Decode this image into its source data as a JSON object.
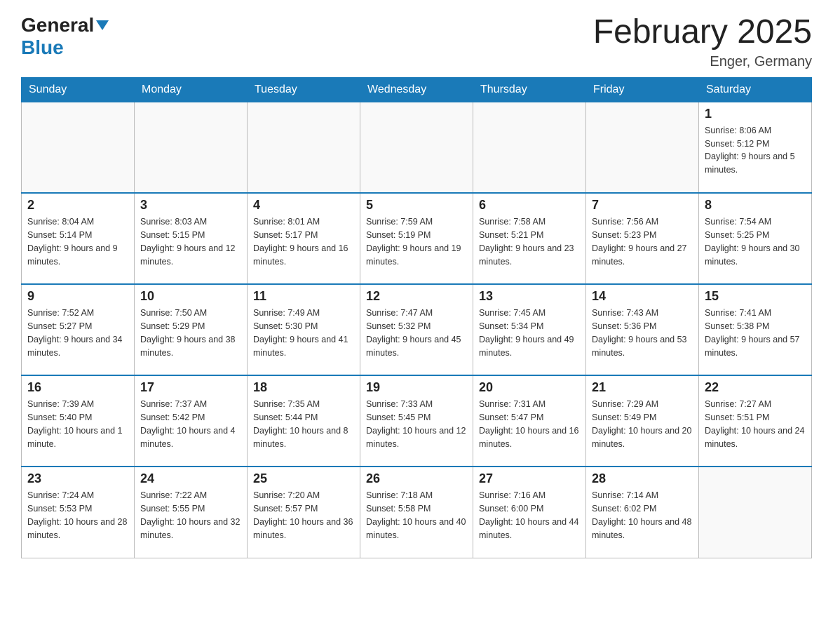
{
  "logo": {
    "general": "General",
    "blue": "Blue",
    "arrow": "▼"
  },
  "title": {
    "month_year": "February 2025",
    "location": "Enger, Germany"
  },
  "days_of_week": [
    "Sunday",
    "Monday",
    "Tuesday",
    "Wednesday",
    "Thursday",
    "Friday",
    "Saturday"
  ],
  "weeks": [
    {
      "days": [
        {
          "number": "",
          "info": ""
        },
        {
          "number": "",
          "info": ""
        },
        {
          "number": "",
          "info": ""
        },
        {
          "number": "",
          "info": ""
        },
        {
          "number": "",
          "info": ""
        },
        {
          "number": "",
          "info": ""
        },
        {
          "number": "1",
          "info": "Sunrise: 8:06 AM\nSunset: 5:12 PM\nDaylight: 9 hours and 5 minutes."
        }
      ]
    },
    {
      "days": [
        {
          "number": "2",
          "info": "Sunrise: 8:04 AM\nSunset: 5:14 PM\nDaylight: 9 hours and 9 minutes."
        },
        {
          "number": "3",
          "info": "Sunrise: 8:03 AM\nSunset: 5:15 PM\nDaylight: 9 hours and 12 minutes."
        },
        {
          "number": "4",
          "info": "Sunrise: 8:01 AM\nSunset: 5:17 PM\nDaylight: 9 hours and 16 minutes."
        },
        {
          "number": "5",
          "info": "Sunrise: 7:59 AM\nSunset: 5:19 PM\nDaylight: 9 hours and 19 minutes."
        },
        {
          "number": "6",
          "info": "Sunrise: 7:58 AM\nSunset: 5:21 PM\nDaylight: 9 hours and 23 minutes."
        },
        {
          "number": "7",
          "info": "Sunrise: 7:56 AM\nSunset: 5:23 PM\nDaylight: 9 hours and 27 minutes."
        },
        {
          "number": "8",
          "info": "Sunrise: 7:54 AM\nSunset: 5:25 PM\nDaylight: 9 hours and 30 minutes."
        }
      ]
    },
    {
      "days": [
        {
          "number": "9",
          "info": "Sunrise: 7:52 AM\nSunset: 5:27 PM\nDaylight: 9 hours and 34 minutes."
        },
        {
          "number": "10",
          "info": "Sunrise: 7:50 AM\nSunset: 5:29 PM\nDaylight: 9 hours and 38 minutes."
        },
        {
          "number": "11",
          "info": "Sunrise: 7:49 AM\nSunset: 5:30 PM\nDaylight: 9 hours and 41 minutes."
        },
        {
          "number": "12",
          "info": "Sunrise: 7:47 AM\nSunset: 5:32 PM\nDaylight: 9 hours and 45 minutes."
        },
        {
          "number": "13",
          "info": "Sunrise: 7:45 AM\nSunset: 5:34 PM\nDaylight: 9 hours and 49 minutes."
        },
        {
          "number": "14",
          "info": "Sunrise: 7:43 AM\nSunset: 5:36 PM\nDaylight: 9 hours and 53 minutes."
        },
        {
          "number": "15",
          "info": "Sunrise: 7:41 AM\nSunset: 5:38 PM\nDaylight: 9 hours and 57 minutes."
        }
      ]
    },
    {
      "days": [
        {
          "number": "16",
          "info": "Sunrise: 7:39 AM\nSunset: 5:40 PM\nDaylight: 10 hours and 1 minute."
        },
        {
          "number": "17",
          "info": "Sunrise: 7:37 AM\nSunset: 5:42 PM\nDaylight: 10 hours and 4 minutes."
        },
        {
          "number": "18",
          "info": "Sunrise: 7:35 AM\nSunset: 5:44 PM\nDaylight: 10 hours and 8 minutes."
        },
        {
          "number": "19",
          "info": "Sunrise: 7:33 AM\nSunset: 5:45 PM\nDaylight: 10 hours and 12 minutes."
        },
        {
          "number": "20",
          "info": "Sunrise: 7:31 AM\nSunset: 5:47 PM\nDaylight: 10 hours and 16 minutes."
        },
        {
          "number": "21",
          "info": "Sunrise: 7:29 AM\nSunset: 5:49 PM\nDaylight: 10 hours and 20 minutes."
        },
        {
          "number": "22",
          "info": "Sunrise: 7:27 AM\nSunset: 5:51 PM\nDaylight: 10 hours and 24 minutes."
        }
      ]
    },
    {
      "days": [
        {
          "number": "23",
          "info": "Sunrise: 7:24 AM\nSunset: 5:53 PM\nDaylight: 10 hours and 28 minutes."
        },
        {
          "number": "24",
          "info": "Sunrise: 7:22 AM\nSunset: 5:55 PM\nDaylight: 10 hours and 32 minutes."
        },
        {
          "number": "25",
          "info": "Sunrise: 7:20 AM\nSunset: 5:57 PM\nDaylight: 10 hours and 36 minutes."
        },
        {
          "number": "26",
          "info": "Sunrise: 7:18 AM\nSunset: 5:58 PM\nDaylight: 10 hours and 40 minutes."
        },
        {
          "number": "27",
          "info": "Sunrise: 7:16 AM\nSunset: 6:00 PM\nDaylight: 10 hours and 44 minutes."
        },
        {
          "number": "28",
          "info": "Sunrise: 7:14 AM\nSunset: 6:02 PM\nDaylight: 10 hours and 48 minutes."
        },
        {
          "number": "",
          "info": ""
        }
      ]
    }
  ]
}
